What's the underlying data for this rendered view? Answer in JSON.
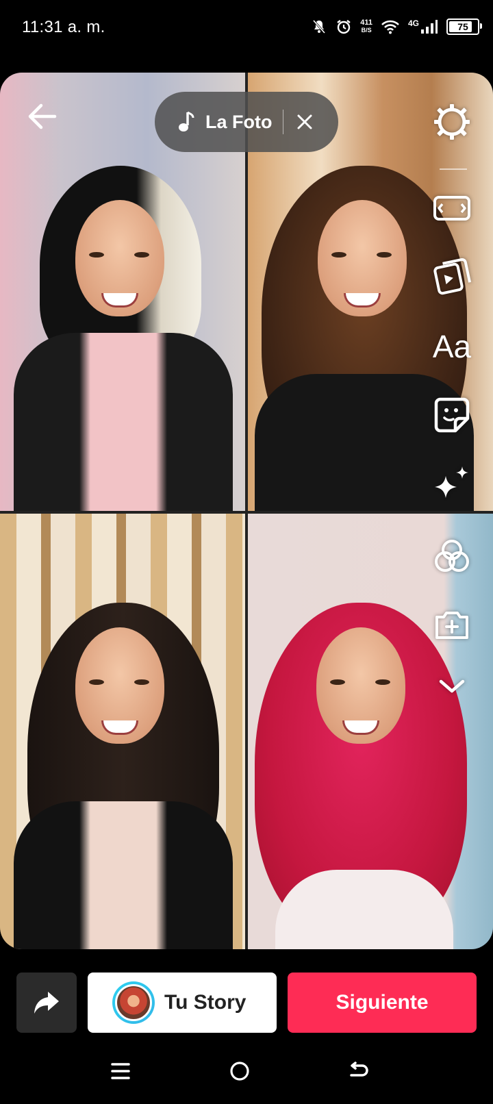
{
  "status_bar": {
    "time": "11:31 a. m.",
    "net_speed_value": "411",
    "net_speed_unit": "B/S",
    "network_type": "4G",
    "battery": "75"
  },
  "music": {
    "title": "La Foto"
  },
  "side_tools": [
    {
      "name": "settings-icon"
    },
    {
      "name": "aspect-ratio-icon"
    },
    {
      "name": "clip-icon"
    },
    {
      "name": "text-tool",
      "label": "Aa"
    },
    {
      "name": "sticker-icon"
    },
    {
      "name": "effects-sparkle-icon"
    },
    {
      "name": "filters-icon"
    },
    {
      "name": "add-clip-icon"
    },
    {
      "name": "expand-chevron-icon"
    }
  ],
  "bottom": {
    "story_label": "Tu Story",
    "next_label": "Siguiente"
  },
  "colors": {
    "accent": "#fe2c55",
    "story_ring": "#2ed0f0"
  }
}
